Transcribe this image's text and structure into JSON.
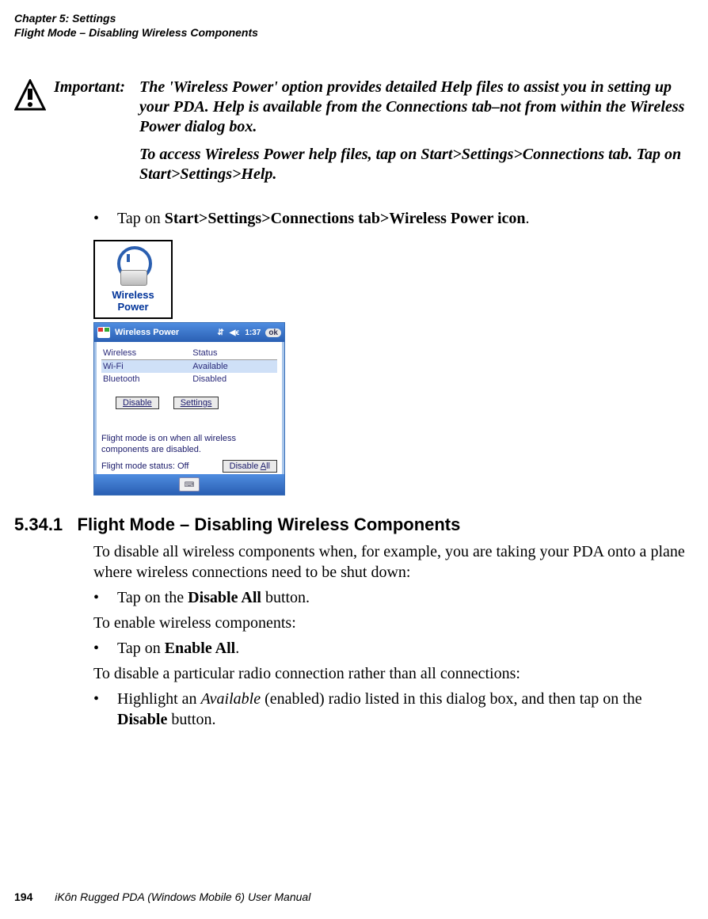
{
  "header": {
    "line1": "Chapter 5: Settings",
    "line2": "Flight Mode – Disabling Wireless Components"
  },
  "important": {
    "label": "Important:",
    "para1": "The 'Wireless Power' option provides detailed Help files to assist you in setting up your PDA. Help is available from the Connections tab–not from within the Wireless Power dialog box.",
    "para2": "To access Wireless Power help files, tap on Start>Settings>Connections tab. Tap on Start>Settings>Help."
  },
  "bullets": {
    "tap_on": "Tap on ",
    "path": "Start>Settings>Connections tab>Wireless Power icon",
    "dot": "."
  },
  "wp_icon": {
    "label_l1": "Wireless",
    "label_l2": "Power"
  },
  "pda": {
    "title": "Wireless Power",
    "time": "1:37",
    "ok": "ok",
    "signal": "⇵",
    "sound": "◀ϵ",
    "cols": {
      "c1": "Wireless",
      "c2": "Status"
    },
    "rows": [
      {
        "name": "Wi-Fi",
        "status": "Available",
        "selected": true
      },
      {
        "name": "Bluetooth",
        "status": "Disabled",
        "selected": false
      }
    ],
    "btn_disable": "Disable",
    "btn_settings": "Settings",
    "note": "Flight mode is on when all wireless components are disabled.",
    "mode_label": "Flight mode status: Off",
    "btn_disable_all_pre": "Disable ",
    "btn_disable_all_u": "A",
    "btn_disable_all_post": "ll",
    "kbd": "⌨"
  },
  "section": {
    "number": "5.34.1",
    "title": "Flight Mode – Disabling Wireless Components",
    "para1": "To disable all wireless components when, for example, you are taking your PDA onto a plane where wireless connections need to be shut down:",
    "bullet1_pre": "Tap on the ",
    "bullet1_bold": "Disable All",
    "bullet1_post": " button.",
    "para2": "To enable wireless components:",
    "bullet2_pre": "Tap on ",
    "bullet2_bold": "Enable All",
    "bullet2_post": ".",
    "para3": "To disable a particular radio connection rather than all connections:",
    "bullet3_pre": "Highlight an ",
    "bullet3_italic": "Available",
    "bullet3_mid": " (enabled) radio listed in this dialog box, and then tap on the ",
    "bullet3_bold": "Disable",
    "bullet3_post": " button."
  },
  "footer": {
    "page": "194",
    "manual": "iKôn Rugged PDA (Windows Mobile 6) User Manual"
  },
  "glyphs": {
    "bullet": "•"
  }
}
